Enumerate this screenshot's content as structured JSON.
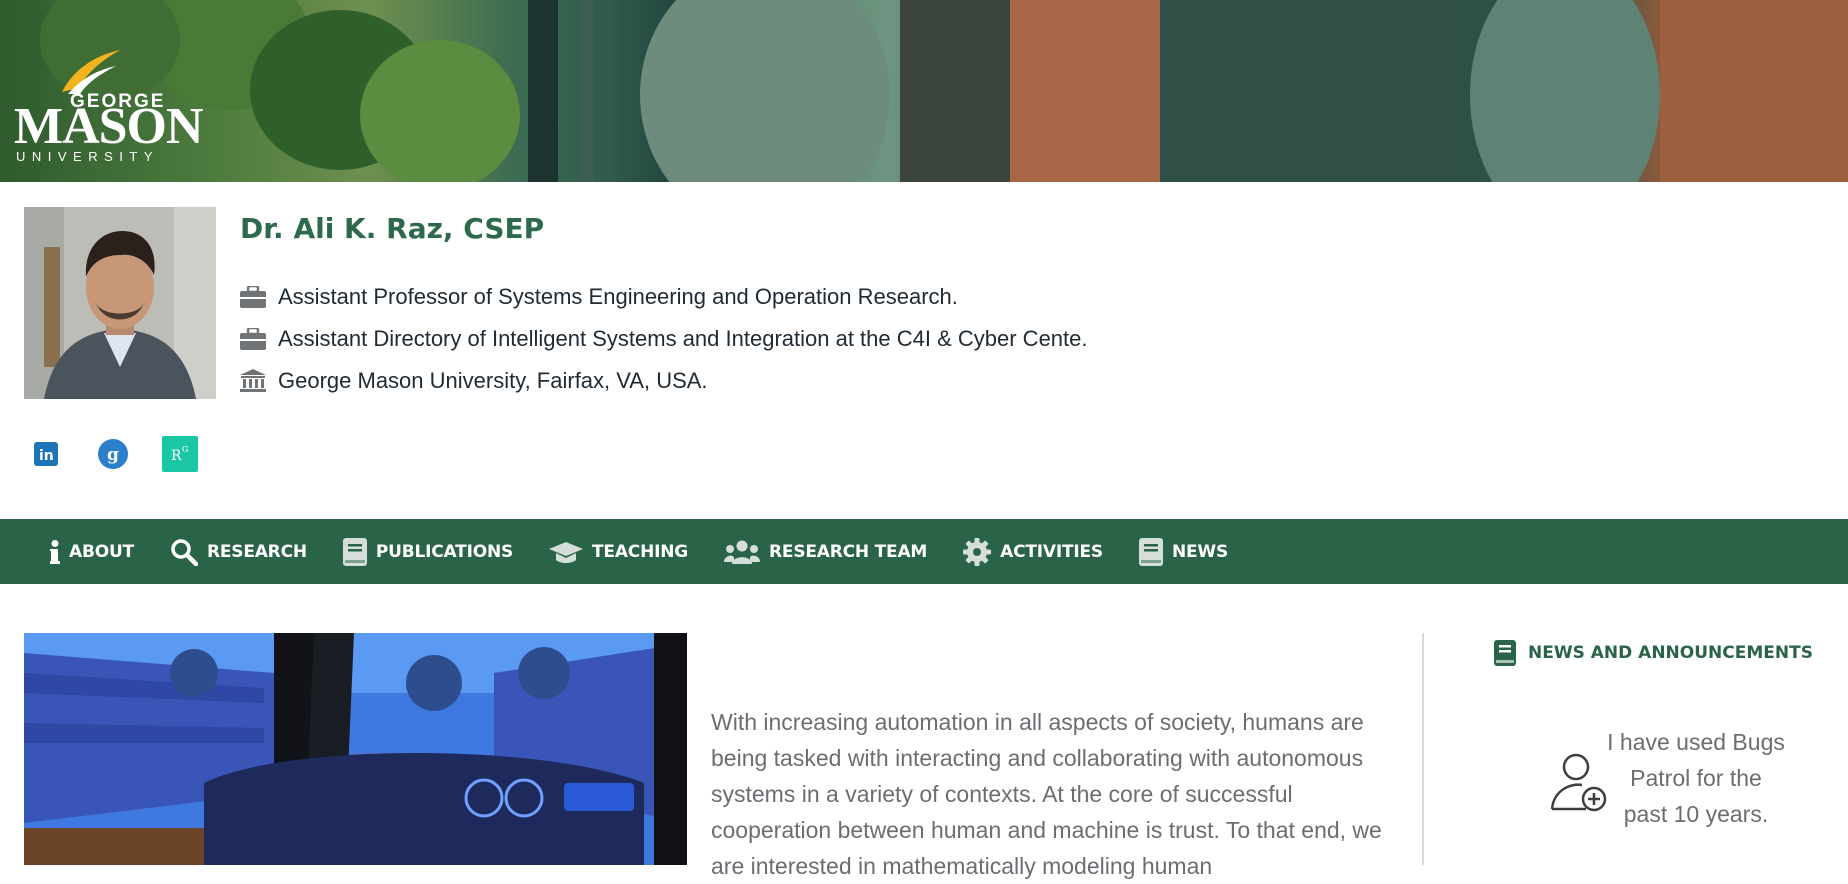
{
  "header": {
    "logo": {
      "line1": "GEORGE",
      "line2": "MASON",
      "line3": "UNIVERSITY"
    }
  },
  "profile": {
    "name": "Dr. Ali K. Raz, CSEP",
    "details": [
      {
        "icon": "briefcase-icon",
        "text": "Assistant Professor of Systems Engineering and Operation Research."
      },
      {
        "icon": "briefcase-icon",
        "text": "Assistant Directory of Intelligent Systems and Integration at the C4I & Cyber Cente."
      },
      {
        "icon": "university-icon",
        "text": "George Mason University, Fairfax, VA, USA."
      }
    ],
    "social": [
      {
        "icon": "linkedin-icon",
        "text": "in",
        "color": "#1d74b7"
      },
      {
        "icon": "google-scholar-icon",
        "text": "g",
        "color": "#2c7fc9"
      },
      {
        "icon": "researchgate-icon",
        "text": "RG",
        "color": "#1ac7a5"
      }
    ]
  },
  "nav": {
    "items": [
      {
        "label": "ABOUT",
        "icon": "info-icon"
      },
      {
        "label": "RESEARCH",
        "icon": "search-icon"
      },
      {
        "label": "PUBLICATIONS",
        "icon": "book-icon"
      },
      {
        "label": "TEACHING",
        "icon": "graduation-cap-icon"
      },
      {
        "label": "RESEARCH TEAM",
        "icon": "users-icon"
      },
      {
        "label": "ACTIVITIES",
        "icon": "gear-icon"
      },
      {
        "label": "NEWS",
        "icon": "book-icon"
      }
    ]
  },
  "main": {
    "intro": "With increasing automation in all aspects of society, humans are being tasked with interacting and collaborating with autonomous systems in a variety of contexts. At the core of successful cooperation between human and machine is trust. To that end, we are interested in mathematically modeling human"
  },
  "sidebar": {
    "title": "NEWS AND ANNOUNCEMENTS",
    "text": "I have used Bugs Patrol for the past 10 years."
  },
  "colors": {
    "brand_green": "#2a6448",
    "heading_green": "#2d6a4b",
    "body_gray": "#6a6e72"
  }
}
